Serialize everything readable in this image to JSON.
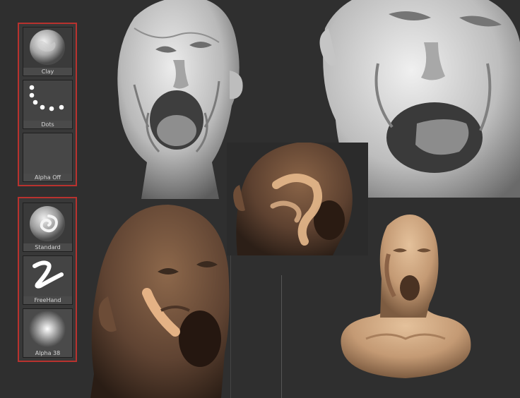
{
  "palettes": {
    "top": {
      "slots": [
        {
          "label": "Clay",
          "icon": "clay-brush-icon"
        },
        {
          "label": "Dots",
          "icon": "dots-stroke-icon"
        },
        {
          "label": "Alpha Off",
          "icon": "alpha-off-icon"
        }
      ]
    },
    "bottom": {
      "slots": [
        {
          "label": "Standard",
          "icon": "standard-brush-icon"
        },
        {
          "label": "FreeHand",
          "icon": "freehand-stroke-icon"
        },
        {
          "label": "Alpha 38",
          "icon": "alpha-38-icon"
        }
      ]
    }
  },
  "colors": {
    "background": "#2f2f2f",
    "palette_border": "#b8322e",
    "grey_clay": "#c9c9c9",
    "brown_clay": "#6b4a33",
    "skin_clay": "#c49a74",
    "stroke_highlight": "#e7b98c"
  }
}
